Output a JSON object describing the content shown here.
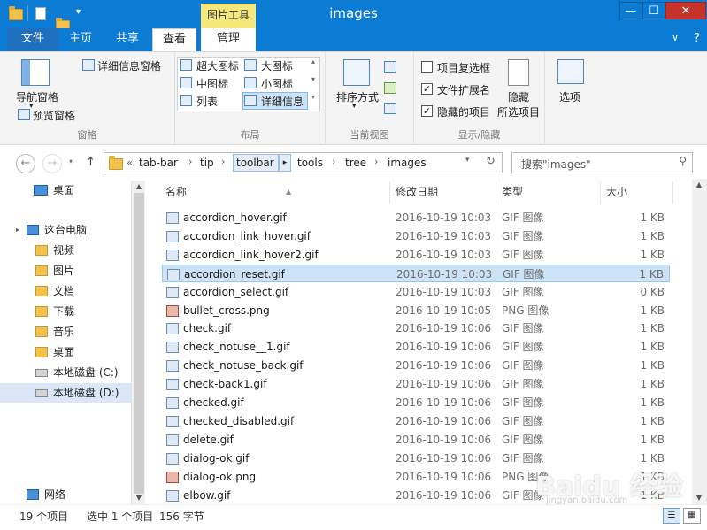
{
  "window": {
    "title": "images",
    "context_tab_group": "图片工具",
    "buttons": {
      "minimize": "—",
      "maximize": "☐",
      "close": "✕"
    }
  },
  "ribbon_tabs": [
    "文件",
    "主页",
    "共享",
    "查看",
    "管理"
  ],
  "ribbon": {
    "panes": {
      "nav_pane": "导航窗格",
      "preview_pane": "预览窗格",
      "details_pane": "详细信息窗格",
      "label": "窗格"
    },
    "layout": {
      "items": [
        "超大图标",
        "大图标",
        "中图标",
        "小图标",
        "列表",
        "详细信息"
      ],
      "label": "布局"
    },
    "current_view": {
      "sort_by": "排序方式",
      "label": "当前视图"
    },
    "show_hide": {
      "item_checkboxes": "项目复选框",
      "file_extensions": "文件扩展名",
      "hidden_items": "隐藏的项目",
      "hide_selected": "隐藏",
      "hide_selected_2": "所选项目",
      "label": "显示/隐藏",
      "item_checkboxes_checked": false,
      "file_extensions_checked": true,
      "hidden_items_checked": true
    },
    "options": "选项"
  },
  "address": {
    "overflow": "«",
    "crumbs": [
      "tab-bar",
      "tip",
      "toolbar",
      "tools",
      "tree",
      "images"
    ],
    "search_placeholder": "搜索\"images\""
  },
  "nav": {
    "items": [
      {
        "label": "桌面",
        "icon": "desktop-icon"
      },
      {
        "label": "这台电脑",
        "icon": "computer-icon"
      },
      {
        "label": "视频",
        "icon": "folder-icon"
      },
      {
        "label": "图片",
        "icon": "folder-icon"
      },
      {
        "label": "文档",
        "icon": "folder-icon"
      },
      {
        "label": "下载",
        "icon": "folder-icon"
      },
      {
        "label": "音乐",
        "icon": "folder-icon"
      },
      {
        "label": "桌面",
        "icon": "folder-icon"
      },
      {
        "label": "本地磁盘 (C:)",
        "icon": "drive-icon"
      },
      {
        "label": "本地磁盘 (D:)",
        "icon": "drive-icon"
      },
      {
        "label": "网络",
        "icon": "network-icon"
      }
    ]
  },
  "columns": [
    "名称",
    "修改日期",
    "类型",
    "大小"
  ],
  "files": [
    {
      "name": "accordion_hover.gif",
      "date": "2016-10-19 10:03",
      "type": "GIF 图像",
      "size": "1 KB",
      "kind": "gif"
    },
    {
      "name": "accordion_link_hover.gif",
      "date": "2016-10-19 10:03",
      "type": "GIF 图像",
      "size": "1 KB",
      "kind": "gif"
    },
    {
      "name": "accordion_link_hover2.gif",
      "date": "2016-10-19 10:03",
      "type": "GIF 图像",
      "size": "1 KB",
      "kind": "gif"
    },
    {
      "name": "accordion_reset.gif",
      "date": "2016-10-19 10:03",
      "type": "GIF 图像",
      "size": "1 KB",
      "kind": "gif",
      "selected": true
    },
    {
      "name": "accordion_select.gif",
      "date": "2016-10-19 10:03",
      "type": "GIF 图像",
      "size": "0 KB",
      "kind": "gif"
    },
    {
      "name": "bullet_cross.png",
      "date": "2016-10-19 10:05",
      "type": "PNG 图像",
      "size": "1 KB",
      "kind": "png"
    },
    {
      "name": "check.gif",
      "date": "2016-10-19 10:06",
      "type": "GIF 图像",
      "size": "1 KB",
      "kind": "gif"
    },
    {
      "name": "check_notuse__1.gif",
      "date": "2016-10-19 10:06",
      "type": "GIF 图像",
      "size": "1 KB",
      "kind": "gif"
    },
    {
      "name": "check_notuse_back.gif",
      "date": "2016-10-19 10:06",
      "type": "GIF 图像",
      "size": "1 KB",
      "kind": "gif"
    },
    {
      "name": "check-back1.gif",
      "date": "2016-10-19 10:06",
      "type": "GIF 图像",
      "size": "1 KB",
      "kind": "gif"
    },
    {
      "name": "checked.gif",
      "date": "2016-10-19 10:06",
      "type": "GIF 图像",
      "size": "1 KB",
      "kind": "gif"
    },
    {
      "name": "checked_disabled.gif",
      "date": "2016-10-19 10:06",
      "type": "GIF 图像",
      "size": "1 KB",
      "kind": "gif"
    },
    {
      "name": "delete.gif",
      "date": "2016-10-19 10:06",
      "type": "GIF 图像",
      "size": "1 KB",
      "kind": "gif"
    },
    {
      "name": "dialog-ok.gif",
      "date": "2016-10-19 10:06",
      "type": "GIF 图像",
      "size": "1 KB",
      "kind": "gif"
    },
    {
      "name": "dialog-ok.png",
      "date": "2016-10-19 10:06",
      "type": "PNG 图像",
      "size": "1 KB",
      "kind": "png"
    },
    {
      "name": "elbow.gif",
      "date": "2016-10-19 10:06",
      "type": "GIF 图像",
      "size": "1 KB",
      "kind": "gif"
    }
  ],
  "status": {
    "count": "19 个项目",
    "selection": "选中 1 个项目",
    "size": "156 字节"
  },
  "watermark": {
    "main": "Baidu 经验",
    "sub": "jingyan.baidu.com"
  }
}
